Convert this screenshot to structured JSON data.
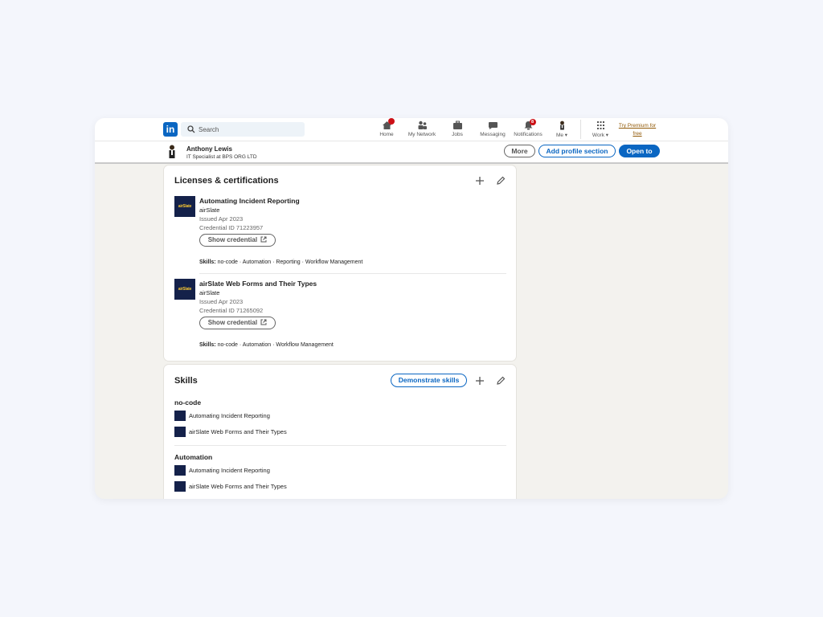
{
  "navbar": {
    "logo_text": "in",
    "search_placeholder": "Search",
    "items": [
      {
        "label": "Home",
        "icon": "home-icon",
        "badge": ""
      },
      {
        "label": "My Network",
        "icon": "network-icon",
        "badge": ""
      },
      {
        "label": "Jobs",
        "icon": "briefcase-icon",
        "badge": ""
      },
      {
        "label": "Messaging",
        "icon": "message-icon",
        "badge": ""
      },
      {
        "label": "Notifications",
        "icon": "bell-icon",
        "badge": "8"
      },
      {
        "label": "Me",
        "icon": "avatar-icon",
        "badge": ""
      },
      {
        "label": "Work",
        "icon": "grid-icon",
        "badge": ""
      }
    ],
    "premium_line1": "Try Premium for",
    "premium_line2": "free"
  },
  "profile_bar": {
    "name": "Anthony Lewis",
    "headline": "IT Specialist at BPS ORG LTD",
    "more_label": "More",
    "add_section_label": "Add profile section",
    "open_to_label": "Open to"
  },
  "licenses": {
    "title": "Licenses & certifications",
    "items": [
      {
        "logo_text": "airSlate",
        "name": "Automating Incident Reporting",
        "issuer": "airSlate",
        "issued": "Issued Apr 2023",
        "credential_id": "Credential ID 71223957",
        "button_label": "Show credential",
        "skills_label": "Skills:",
        "skills": "no-code · Automation · Reporting · Workflow Management"
      },
      {
        "logo_text": "airSlate",
        "name": "airSlate Web Forms and Their Types",
        "issuer": "airSlate",
        "issued": "Issued Apr 2023",
        "credential_id": "Credential ID 71265092",
        "button_label": "Show credential",
        "skills_label": "Skills:",
        "skills": "no-code · Automation · Workflow Management"
      }
    ]
  },
  "skills": {
    "title": "Skills",
    "demonstrate_label": "Demonstrate skills",
    "groups": [
      {
        "name": "no-code",
        "items": [
          "Automating Incident Reporting",
          "airSlate Web Forms and Their Types"
        ]
      },
      {
        "name": "Automation",
        "items": [
          "Automating Incident Reporting",
          "airSlate Web Forms and Their Types"
        ]
      }
    ]
  },
  "colors": {
    "brand": "#0a66c2",
    "badge": "#cc1016",
    "premium": "#915907"
  }
}
